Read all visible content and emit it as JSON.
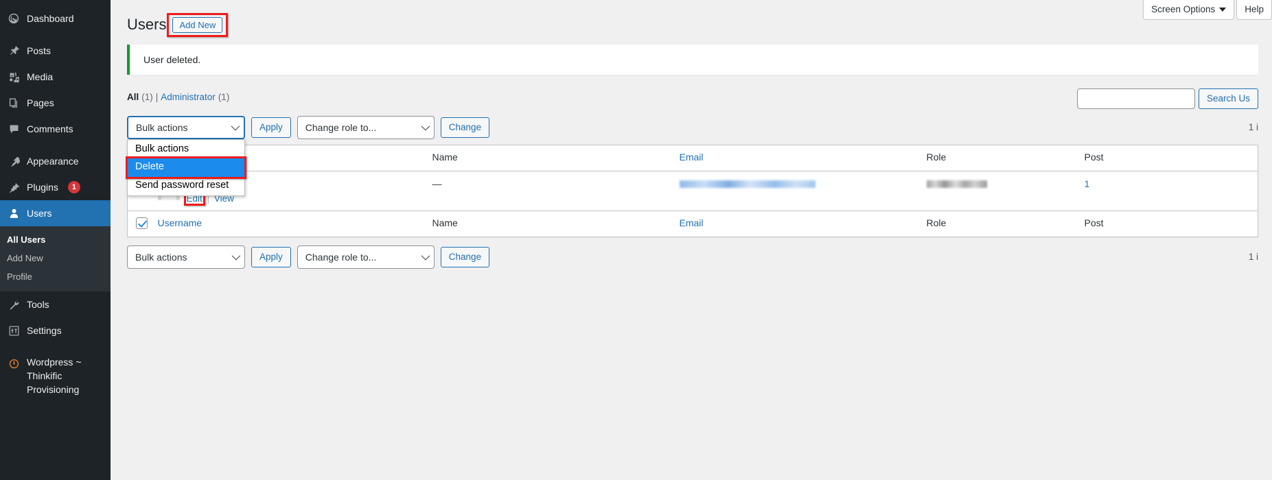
{
  "sidebar": {
    "items": [
      {
        "label": "Dashboard",
        "icon": "dashboard-icon",
        "name": "sidebar-item-dashboard",
        "current": false
      },
      {
        "label": "Posts",
        "icon": "pin-icon",
        "name": "sidebar-item-posts",
        "current": false
      },
      {
        "label": "Media",
        "icon": "media-icon",
        "name": "sidebar-item-media",
        "current": false
      },
      {
        "label": "Pages",
        "icon": "pages-icon",
        "name": "sidebar-item-pages",
        "current": false
      },
      {
        "label": "Comments",
        "icon": "comment-icon",
        "name": "sidebar-item-comments",
        "current": false
      },
      {
        "label": "Appearance",
        "icon": "paintbrush-icon",
        "name": "sidebar-item-appearance",
        "current": false
      },
      {
        "label": "Plugins",
        "icon": "plug-icon",
        "name": "sidebar-item-plugins",
        "current": false,
        "badge": "1"
      },
      {
        "label": "Users",
        "icon": "user-icon",
        "name": "sidebar-item-users",
        "current": true
      },
      {
        "label": "Tools",
        "icon": "wrench-icon",
        "name": "sidebar-item-tools",
        "current": false
      },
      {
        "label": "Settings",
        "icon": "settings-icon",
        "name": "sidebar-item-settings",
        "current": false
      },
      {
        "label": "Wordpress ~ Thinkific Provisioning",
        "icon": "thinkific-icon",
        "name": "sidebar-item-thinkific-provisioning",
        "current": false
      }
    ],
    "submenu": [
      {
        "label": "All Users",
        "active": true
      },
      {
        "label": "Add New",
        "active": false
      },
      {
        "label": "Profile",
        "active": false
      }
    ]
  },
  "screen_meta": {
    "screen_options": "Screen Options",
    "help": "Help"
  },
  "header": {
    "title": "Users",
    "add_new": "Add New"
  },
  "notice": {
    "message": "User deleted.",
    "accent_color": "#00a32a"
  },
  "filters": {
    "all_label": "All",
    "all_count": "(1)",
    "separator": "|",
    "administrator_label": "Administrator",
    "administrator_count": "(1)"
  },
  "search": {
    "value": "",
    "placeholder": "",
    "button_label": "Search Us"
  },
  "toolbar_top": {
    "bulk_actions_value": "Bulk actions",
    "apply_label": "Apply",
    "change_role_value": "Change role to...",
    "change_label": "Change",
    "item_count": "1 i"
  },
  "toolbar_bottom": {
    "bulk_actions_value": "Bulk actions",
    "apply_label": "Apply",
    "change_role_value": "Change role to...",
    "change_label": "Change",
    "item_count": "1 i"
  },
  "bulk_dropdown": {
    "open": true,
    "options": [
      {
        "label": "Bulk actions",
        "selected": false
      },
      {
        "label": "Delete",
        "selected": true
      },
      {
        "label": "Send password reset",
        "selected": false
      }
    ],
    "highlight_color": "#1b8ceb"
  },
  "table": {
    "columns": [
      {
        "key": "cb",
        "label": ""
      },
      {
        "key": "username",
        "label": "Username",
        "link": true
      },
      {
        "key": "name",
        "label": "Name",
        "link": false
      },
      {
        "key": "email",
        "label": "Email",
        "link": true
      },
      {
        "key": "role",
        "label": "Role",
        "link": false
      },
      {
        "key": "posts",
        "label": "Post",
        "link": false
      }
    ],
    "header_cb_checked": false,
    "footer_cb_checked": true,
    "rows": [
      {
        "checked": true,
        "username": "",
        "username_redacted": true,
        "name": "—",
        "email": "",
        "email_redacted": true,
        "role": "",
        "role_redacted": true,
        "posts": "1",
        "actions": [
          {
            "label": "Edit",
            "highlighted": true
          },
          {
            "label": "View",
            "highlighted": false
          }
        ],
        "action_divider": "|"
      }
    ]
  },
  "annotations": {
    "color": "#ee1c1c",
    "targets": [
      "add-new-button",
      "bulk-delete-option",
      "row-edit-link"
    ]
  }
}
